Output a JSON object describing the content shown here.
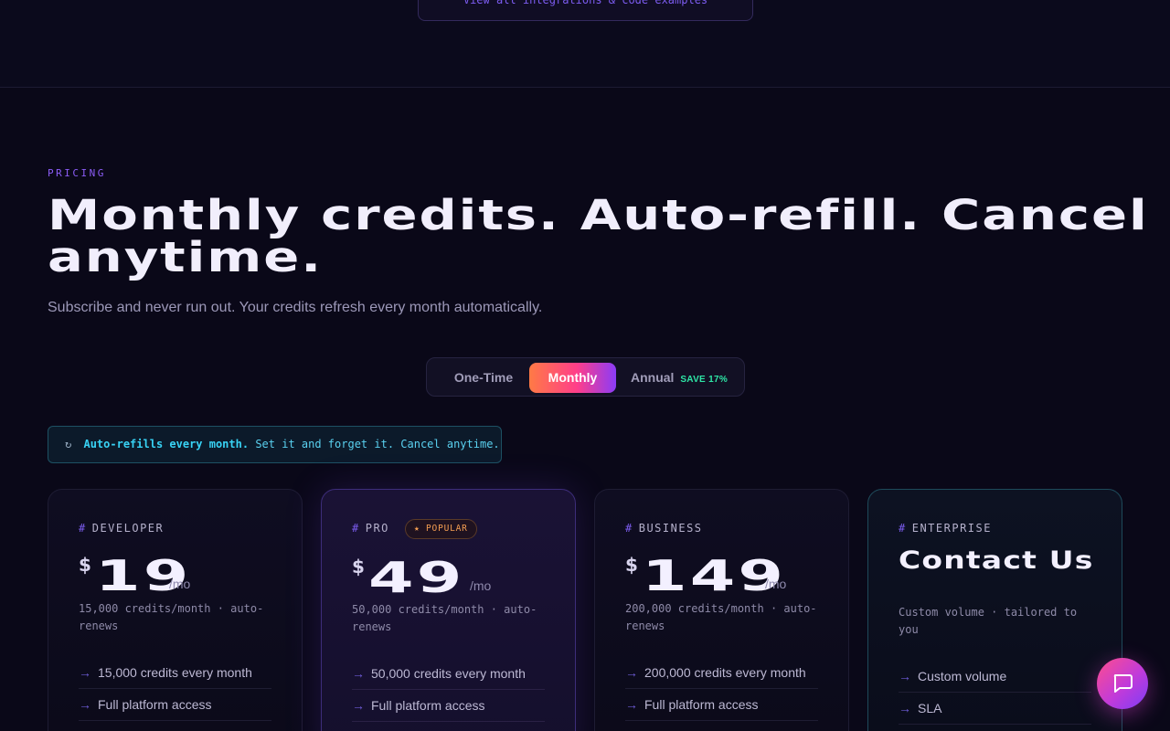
{
  "top": {
    "link_label": "View all integrations & code examples"
  },
  "pricing": {
    "eyebrow": "PRICING",
    "headline": "Monthly credits. Auto-refill. Cancel anytime.",
    "subhead": "Subscribe and never run out. Your credits refresh every month automatically.",
    "toggle": {
      "options": [
        {
          "label": "One-Time"
        },
        {
          "label": "Monthly",
          "selected": true
        },
        {
          "label": "Annual",
          "badge": "SAVE 17%"
        }
      ]
    },
    "notice": {
      "icon": "refresh-icon",
      "strong": "Auto-refills every month.",
      "text": "Set it and forget it. Cancel anytime."
    },
    "plans": [
      {
        "name": "DEVELOPER",
        "currency": "$",
        "price": "19",
        "period": "/mo",
        "note": "15,000 credits/month · auto-renews",
        "features": [
          "15,000 credits every month",
          "Full platform access"
        ]
      },
      {
        "name": "PRO",
        "badge": "★ POPULAR",
        "currency": "$",
        "price": "49",
        "period": "/mo",
        "note": "50,000 credits/month · auto-renews",
        "features": [
          "50,000 credits every month",
          "Full platform access"
        ]
      },
      {
        "name": "BUSINESS",
        "currency": "$",
        "price": "149",
        "period": "/mo",
        "note": "200,000 credits/month · auto-renews",
        "features": [
          "200,000 credits every month",
          "Full platform access"
        ]
      },
      {
        "name": "ENTERPRISE",
        "title": "Contact Us",
        "note": "Custom volume · tailored to you",
        "features": [
          "Custom volume",
          "SLA"
        ]
      }
    ]
  },
  "chat": {
    "icon": "chat-icon"
  },
  "colors": {
    "background": "#0a0818",
    "accent_purple": "#8b5cf6",
    "accent_cyan": "#38d3f5",
    "accent_green": "#2ee6a6",
    "popular_orange": "#f59e52"
  }
}
